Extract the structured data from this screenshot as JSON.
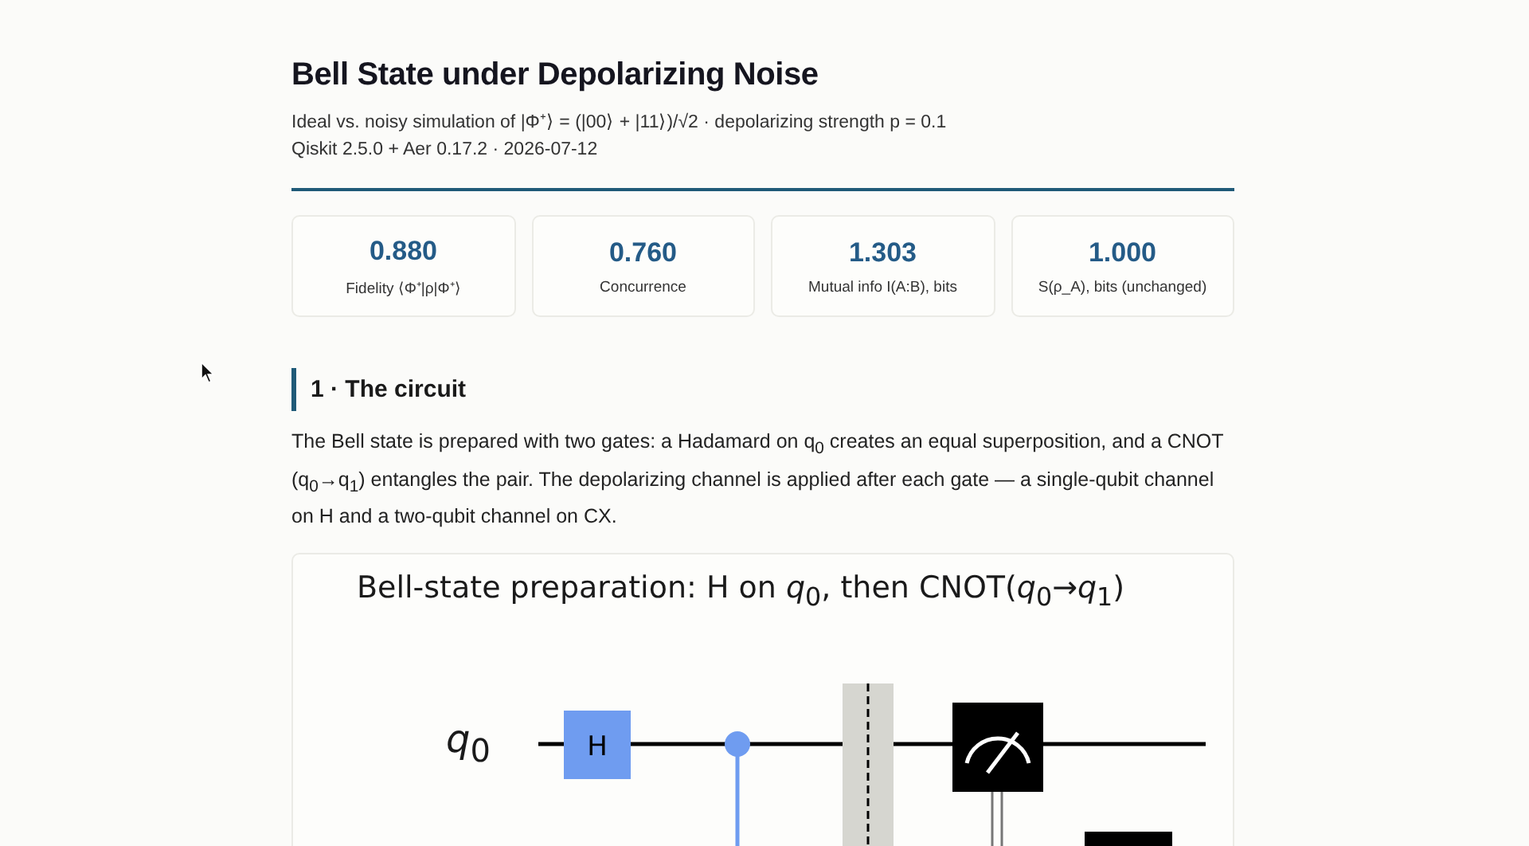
{
  "header": {
    "title": "Bell State under Depolarizing Noise",
    "subtitle": "Ideal vs. noisy simulation of |Φ⁺⟩ = (|00⟩ + |11⟩)/√2  ·  depolarizing strength p = 0.1",
    "meta": "Qiskit 2.5.0 + Aer 0.17.2  ·  2026-07-12"
  },
  "metrics": [
    {
      "value": "0.880",
      "label": "Fidelity ⟨Φ⁺|ρ|Φ⁺⟩"
    },
    {
      "value": "0.760",
      "label": "Concurrence"
    },
    {
      "value": "1.303",
      "label": "Mutual info I(A:B), bits"
    },
    {
      "value": "1.000",
      "label": "S(ρ_A), bits (unchanged)"
    }
  ],
  "section": {
    "heading": "1 · The circuit",
    "body": "The Bell state is prepared with two gates: a Hadamard on q$_{0}$ creates an equal superposition, and a CNOT (q$_{0}$→q$_{1}$) entangles the pair. The depolarizing channel is applied after each gate — a single-qubit channel on H and a two-qubit channel on CX."
  },
  "figure": {
    "title": "Bell-state preparation:  H on *q*$_{0}$, then CNOT(*q*$_{0}$→*q*$_{1}$)",
    "wire_label": "*q*$_{0}$",
    "gate_label": "H"
  }
}
